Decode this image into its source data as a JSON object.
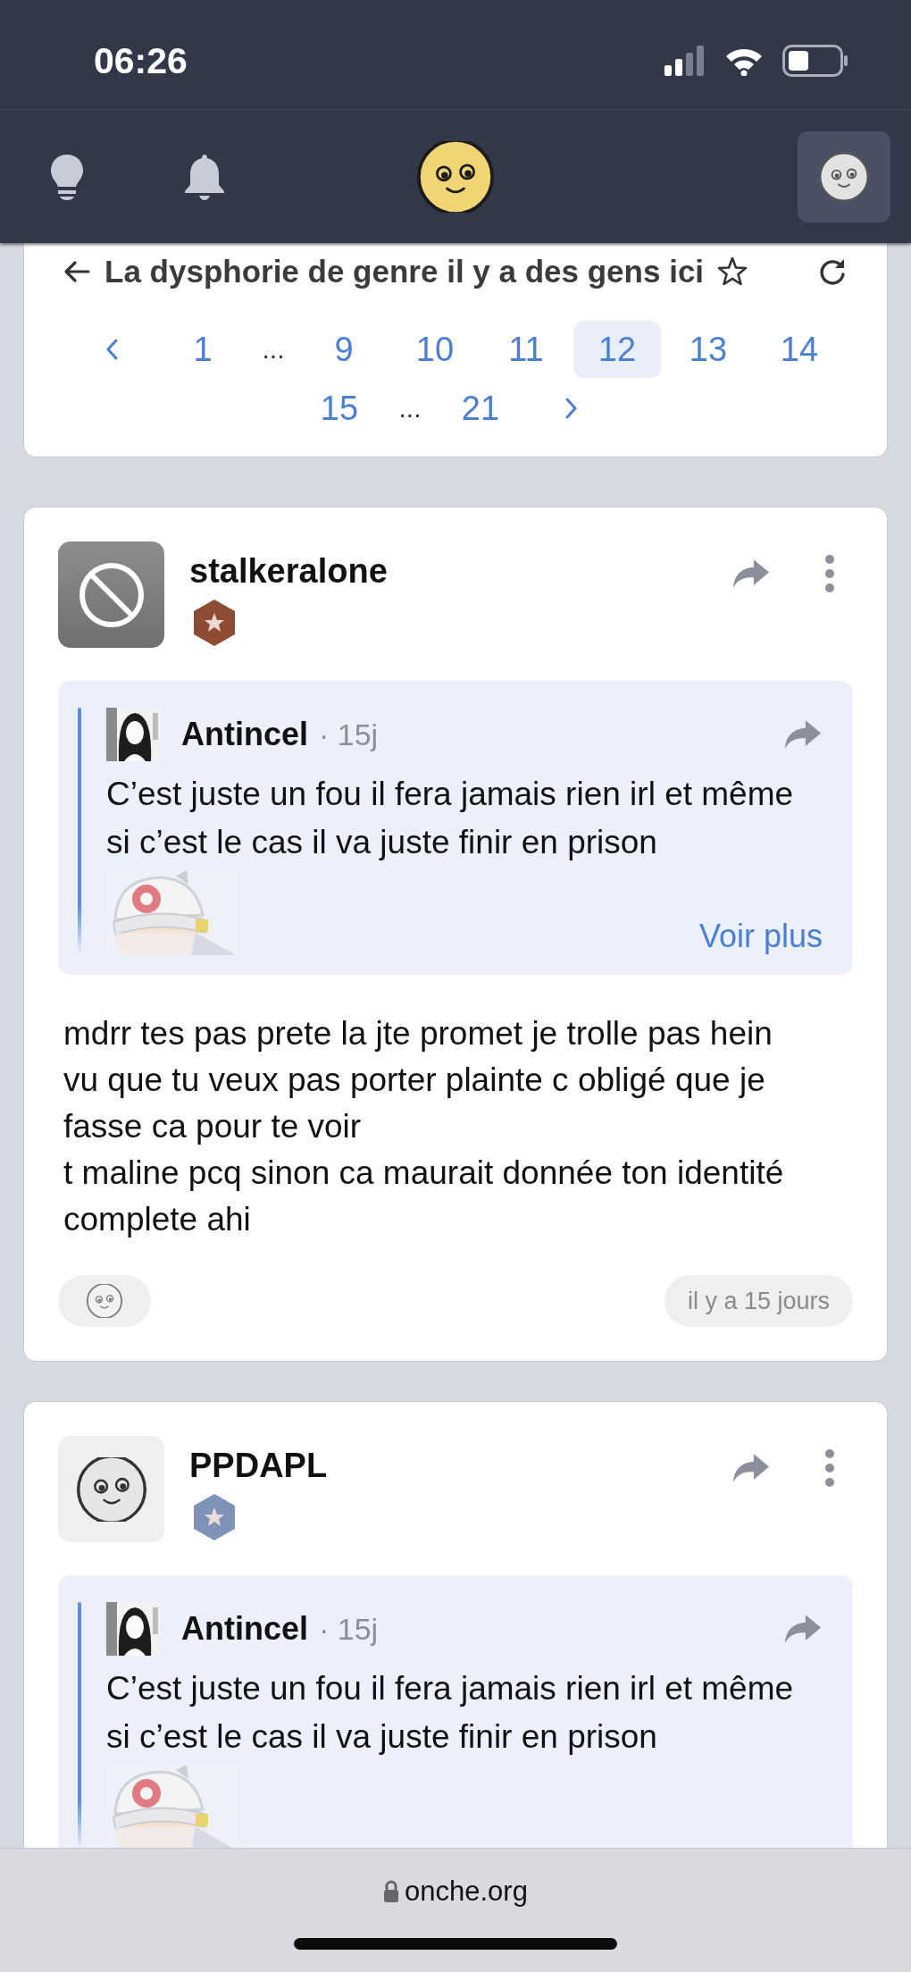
{
  "status_bar": {
    "time": "06:26"
  },
  "topic": {
    "title": "La dysphorie de genre il y a des gens ici",
    "pages": [
      {
        "kind": "page",
        "label": "1",
        "selected": false
      },
      {
        "kind": "gap",
        "label": "..."
      },
      {
        "kind": "page",
        "label": "9",
        "selected": false
      },
      {
        "kind": "page",
        "label": "10",
        "selected": false
      },
      {
        "kind": "page",
        "label": "11",
        "selected": false
      },
      {
        "kind": "page",
        "label": "12",
        "selected": true
      },
      {
        "kind": "page",
        "label": "13",
        "selected": false
      },
      {
        "kind": "page",
        "label": "14",
        "selected": false
      },
      {
        "kind": "page",
        "label": "15",
        "selected": false
      },
      {
        "kind": "gap",
        "label": "..."
      },
      {
        "kind": "page",
        "label": "21",
        "selected": false
      }
    ]
  },
  "posts": [
    {
      "author": "stalkeralone",
      "avatar": {
        "kind": "blocked"
      },
      "badge": {
        "color": "#8e4b33"
      },
      "quote": {
        "author": "Antincel",
        "meta": "· 15j",
        "text": "C’est juste un fou il fera jamais rien irl et même si c’est le cas il va juste finir en prison",
        "more": "Voir plus"
      },
      "body": "mdrr tes pas prete la jte promet je trolle pas hein vu que tu veux pas porter plainte c obligé que je fasse ca pour te voir\nt maline pcq sinon ca maurait donnée ton identité complete ahi",
      "date": "il y a 15 jours"
    },
    {
      "author": "PPDAPL",
      "avatar": {
        "kind": "default"
      },
      "badge": {
        "color": "#7f93b8"
      },
      "quote": {
        "author": "Antincel",
        "meta": "· 15j",
        "text": "C’est juste un fou il fera jamais rien irl et même si c’est le cas il va juste finir en prison"
      }
    }
  ],
  "browser": {
    "url": "onche.org"
  }
}
